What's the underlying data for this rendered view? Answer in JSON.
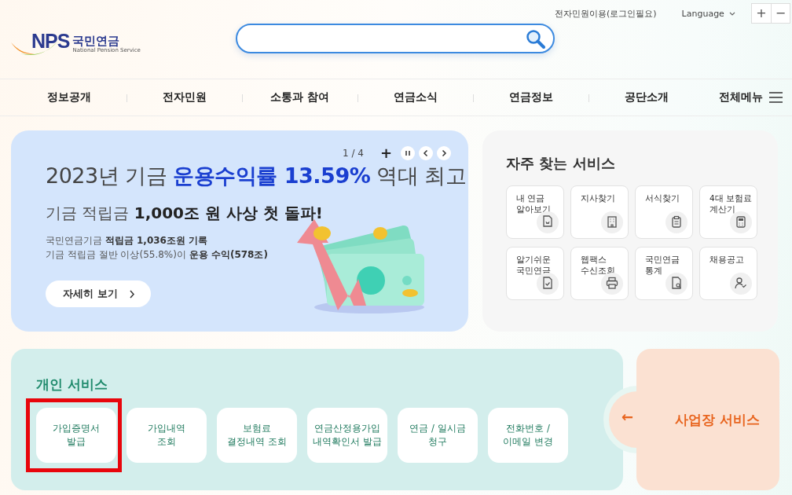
{
  "header": {
    "logo": {
      "mark": "NPS",
      "name": "국민연금",
      "subtitle": "National Pension Service"
    },
    "utility_links": [
      {
        "label": "전자민원이용(로그인필요)",
        "kind": "link"
      },
      {
        "label": "Language",
        "kind": "dropdown"
      }
    ],
    "zoom_buttons": [
      "+",
      "−"
    ]
  },
  "nav": {
    "items": [
      "정보공개",
      "전자민원",
      "소통과 참여",
      "연금소식",
      "연금정보",
      "공단소개"
    ],
    "all_menu": "전체메뉴"
  },
  "banner": {
    "counter": "1 / 4",
    "plus": "+",
    "title": "2023년 기금 **운용수익률 13.59%** 역대 최고",
    "subtitle": "기금 적립금 **1,000조 원 사상 첫 돌파!**",
    "lines": [
      "국민연금기금 **적립금 1,036조원 기록**",
      "기금 적립금 절반 이상(55.8%)이 **운용 수익(578조)**"
    ],
    "button": "자세히 보기"
  },
  "frequent": {
    "title": "자주 찾는 서비스",
    "items": [
      {
        "label": "내 연금\n알아보기",
        "kind": "document"
      },
      {
        "label": "지사찾기",
        "kind": "building"
      },
      {
        "label": "서식찾기",
        "kind": "clipboard"
      },
      {
        "label": "4대 보험료\n계산기",
        "kind": "calculator"
      },
      {
        "label": "알기쉬운\n국민연금",
        "kind": "check"
      },
      {
        "label": "웹팩스\n수신조회",
        "kind": "printer"
      },
      {
        "label": "국민연금\n통계",
        "kind": "search"
      },
      {
        "label": "채용공고",
        "kind": "person"
      }
    ]
  },
  "personal": {
    "title": "개인 서비스",
    "items": [
      {
        "label": "가입증명서\n발급",
        "highlighted": true
      },
      {
        "label": "가입내역\n조회",
        "highlighted": false
      },
      {
        "label": "보험료\n결정내역 조회",
        "highlighted": false
      },
      {
        "label": "연금산정용가입\n내역확인서 발급",
        "highlighted": false
      },
      {
        "label": "연금 / 일시금\n청구",
        "highlighted": false
      },
      {
        "label": "전화번호 /\n이메일 변경",
        "highlighted": false
      }
    ]
  },
  "business": {
    "arrow": "←",
    "label": "사업장 서비스"
  }
}
